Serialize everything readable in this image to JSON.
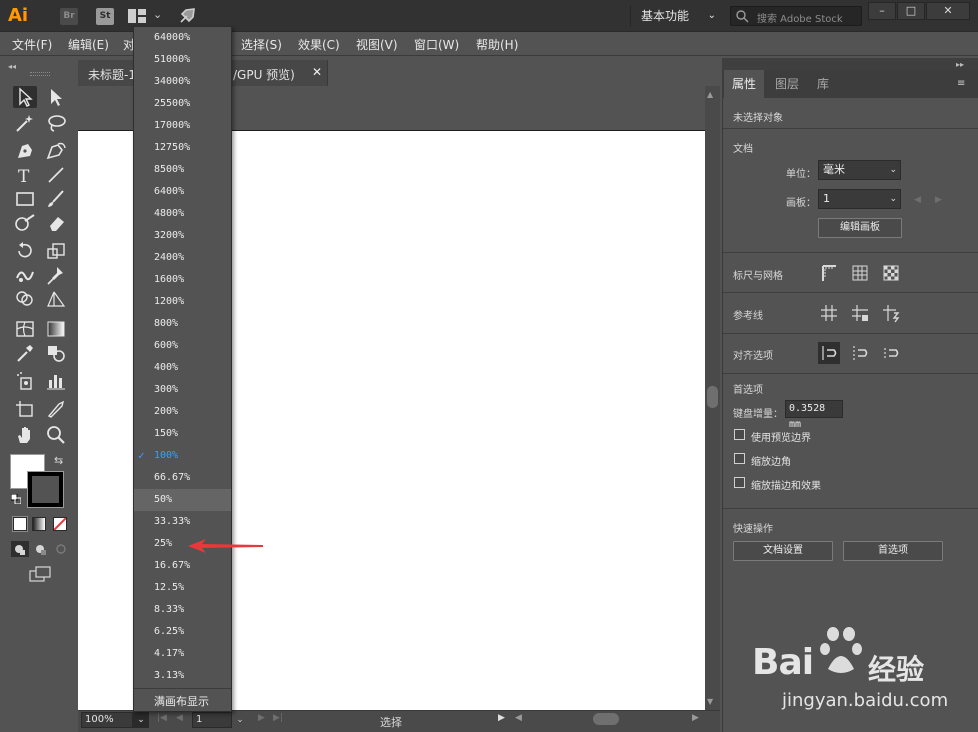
{
  "app": {
    "logo_text": "Ai",
    "br_badge": "Br",
    "st_badge": "St",
    "workspace": "基本功能",
    "stock_search_placeholder": "搜索 Adobe Stock",
    "win_min": "–",
    "win_max": "□",
    "win_close": "✕"
  },
  "menus": [
    "文件(F)",
    "编辑(E)",
    "对",
    "选择(S)",
    "效果(C)",
    "视图(V)",
    "窗口(W)",
    "帮助(H)"
  ],
  "document_tab": {
    "title_left": "未标题-1",
    "title_right": "/GPU 预览)",
    "close": "✕"
  },
  "zoom_menu": {
    "options": [
      "64000%",
      "51000%",
      "34000%",
      "25500%",
      "17000%",
      "12750%",
      "8500%",
      "6400%",
      "4800%",
      "3200%",
      "2400%",
      "1600%",
      "1200%",
      "800%",
      "600%",
      "400%",
      "300%",
      "200%",
      "150%",
      "100%",
      "66.67%",
      "50%",
      "33.33%",
      "25%",
      "16.67%",
      "12.5%",
      "8.33%",
      "6.25%",
      "4.17%",
      "3.13%"
    ],
    "checked": "100%",
    "highlighted": "50%",
    "fit_label": "满画布显示",
    "check_mark": "✓"
  },
  "status_bar": {
    "zoom_value": "100%",
    "artboard_number": "1",
    "status_text": "选择"
  },
  "panel": {
    "tabs": [
      "属性",
      "图层",
      "库"
    ],
    "active_tab": "属性",
    "no_selection": "未选择对象",
    "document_label": "文档",
    "units_label": "单位：",
    "units_value": "毫米",
    "artboard_label": "画板：",
    "artboard_value": "1",
    "edit_artboards_button": "编辑画板",
    "rulers_grids_label": "标尺与网格",
    "guides_label": "参考线",
    "align_options_label": "对齐选项",
    "preferences_label": "首选项",
    "keyboard_increment_label": "键盘增量：",
    "keyboard_increment_value": "0.3528 mm",
    "checkboxes": [
      "使用预览边界",
      "缩放边角",
      "缩放描边和效果"
    ],
    "quick_actions_label": "快速操作",
    "doc_setup_button": "文档设置",
    "preferences_button": "首选项"
  },
  "watermark": {
    "brand": "Bai",
    "brand_cn": "经验",
    "url": "jingyan.baidu.com"
  },
  "colors": {
    "accent_check": "#3d9eff",
    "annotation_arrow": "#e8383a",
    "ai_logo": "#ff9a00"
  }
}
